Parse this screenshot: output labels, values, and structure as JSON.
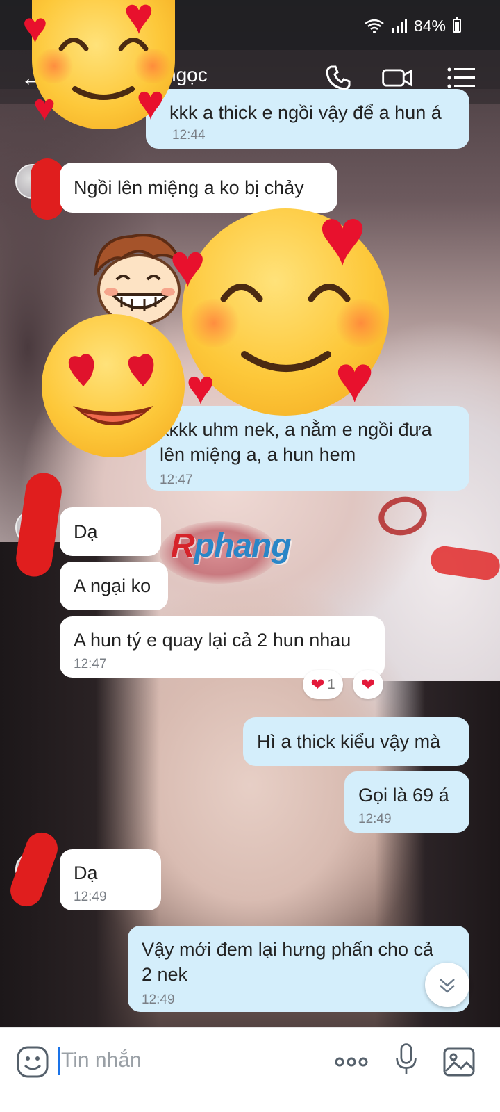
{
  "status_bar": {
    "battery_text": "84%"
  },
  "header": {
    "contact_name": "ngọc"
  },
  "messages": [
    {
      "dir": "out",
      "text": "kkk a thick e ngồi vậy để a hun á",
      "time": "12:44"
    },
    {
      "dir": "in",
      "text": "Ngồi lên miệng a ko bị chảy",
      "time": ""
    },
    {
      "dir": "out",
      "text_lines": [
        "kkkk uhm nek, a nằm e ngồi đưa",
        "lên miệng a, a hun hem"
      ],
      "time": "12:47"
    },
    {
      "dir": "in",
      "text": "Dạ",
      "time": ""
    },
    {
      "dir": "in",
      "text": "A ngại ko",
      "time": ""
    },
    {
      "dir": "in",
      "text": "A hun tý e quay lại cả 2 hun nhau",
      "time": "12:47"
    },
    {
      "dir": "out",
      "text": "Hì a thick kiểu vậy mà",
      "time": ""
    },
    {
      "dir": "out",
      "text": "Gọi là 69 á",
      "time": "12:49"
    },
    {
      "dir": "in",
      "text": "Dạ",
      "time": "12:49"
    },
    {
      "dir": "out",
      "text_lines": [
        "Vậy mới đem lại hưng phấn cho cả",
        "2 nek"
      ],
      "time": "12:49"
    }
  ],
  "reactions": {
    "heart_count": "1"
  },
  "watermark": {
    "r": "R",
    "rest": "phang"
  },
  "input": {
    "placeholder": "Tin nhắn"
  },
  "icons": {
    "back": "back-arrow-icon",
    "call": "phone-icon",
    "video": "video-camera-icon",
    "menu": "list-menu-icon",
    "emoji": "emoji-smile-icon",
    "more": "more-dots-icon",
    "mic": "microphone-icon",
    "image": "image-gallery-icon",
    "scroll": "chevron-down-icon"
  }
}
